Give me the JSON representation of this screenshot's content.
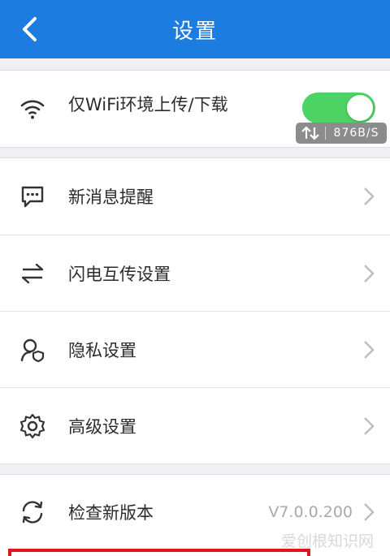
{
  "header": {
    "title": "设置"
  },
  "wifi_section": {
    "label": "仅WiFi环境上传/下载",
    "toggle_on": true,
    "speed": "876B/S"
  },
  "menu": {
    "items": [
      {
        "label": "新消息提醒",
        "icon": "chat-bubble-icon"
      },
      {
        "label": "闪电互传设置",
        "icon": "transfer-arrows-icon"
      },
      {
        "label": "隐私设置",
        "icon": "privacy-user-shield-icon"
      },
      {
        "label": "高级设置",
        "icon": "gear-icon"
      }
    ]
  },
  "update": {
    "label": "检查新版本",
    "version": "V7.0.0.200"
  },
  "watermark": "爱创根知识网",
  "colors": {
    "header": "#1c7ce0",
    "toggle": "#4cd364",
    "highlight_box": "#e0141e"
  }
}
